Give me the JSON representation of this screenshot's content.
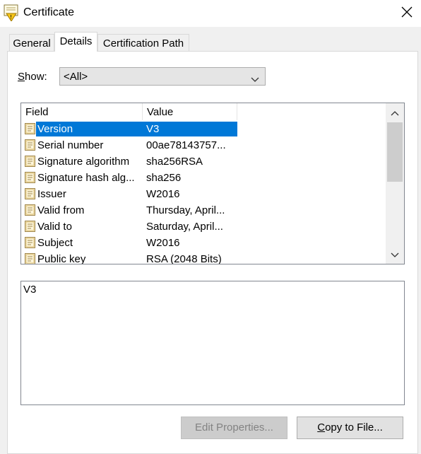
{
  "window": {
    "title": "Certificate"
  },
  "tabs": [
    {
      "label": "General",
      "active": false
    },
    {
      "label": "Details",
      "active": true
    },
    {
      "label": "Certification Path",
      "active": false
    }
  ],
  "show": {
    "label": "Show:",
    "label_underline": "S",
    "label_rest": "how:",
    "selected": "<All>"
  },
  "list": {
    "columns": [
      "Field",
      "Value"
    ],
    "rows": [
      {
        "field": "Version",
        "value": "V3",
        "selected": true
      },
      {
        "field": "Serial number",
        "value": "00ae78143757...",
        "selected": false
      },
      {
        "field": "Signature algorithm",
        "value": "sha256RSA",
        "selected": false
      },
      {
        "field": "Signature hash alg...",
        "value": "sha256",
        "selected": false
      },
      {
        "field": "Issuer",
        "value": "W2016",
        "selected": false
      },
      {
        "field": "Valid from",
        "value": "Thursday, April...",
        "selected": false
      },
      {
        "field": "Valid to",
        "value": "Saturday, April...",
        "selected": false
      },
      {
        "field": "Subject",
        "value": "W2016",
        "selected": false
      },
      {
        "field": "Public key",
        "value": "RSA (2048 Bits)",
        "selected": false
      }
    ]
  },
  "detail": {
    "text": "V3"
  },
  "buttons": {
    "edit_properties": "Edit Properties...",
    "edit_properties_enabled": false,
    "copy_to_file": "Copy to File...",
    "copy_to_file_underline": "C",
    "copy_to_file_rest": "opy to File..."
  },
  "colors": {
    "selection": "#0078d7",
    "window_bg": "#f0f0f0"
  },
  "icons": {
    "app": "certificate-icon",
    "field": "certificate-field-icon",
    "close": "close-icon"
  }
}
